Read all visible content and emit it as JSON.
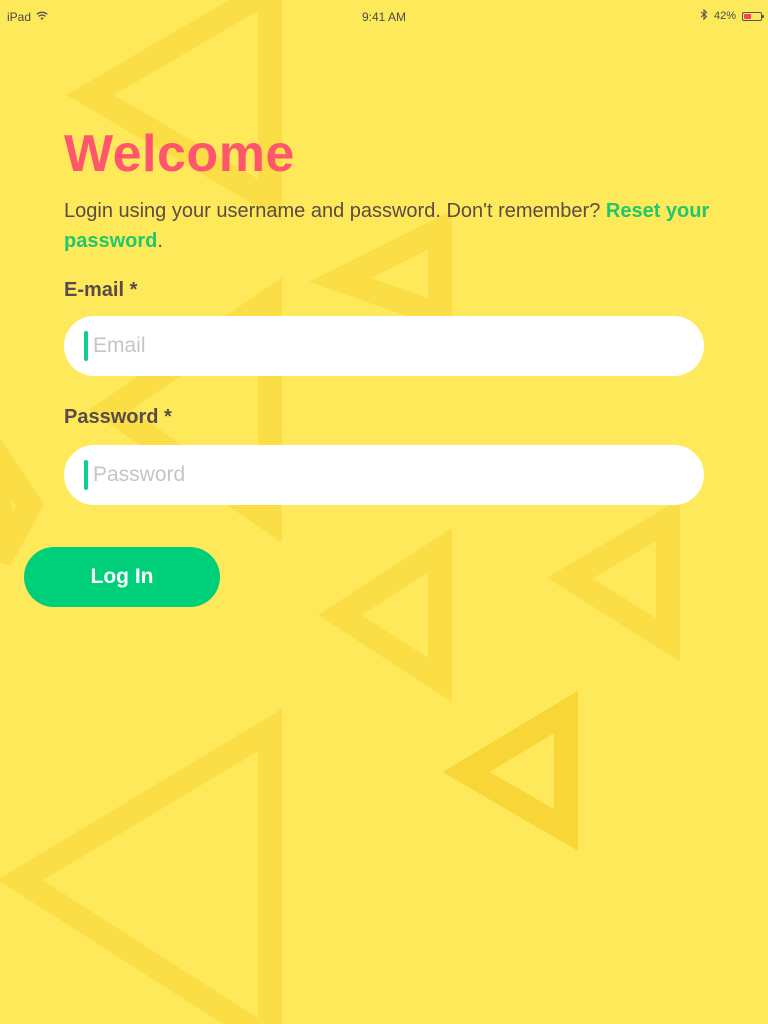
{
  "status_bar": {
    "device": "iPad",
    "time": "9:41 AM",
    "battery_percent": "42%",
    "battery_level": 0.42,
    "icons": [
      "wifi-icon",
      "bluetooth-icon",
      "battery-icon"
    ]
  },
  "login": {
    "title": "Welcome",
    "intro_text": "Login using your username and password. Don't remember? ",
    "reset_link": "Reset your password",
    "reset_suffix": ".",
    "email_label": "E-mail *",
    "email_placeholder": "Email",
    "email_value": "",
    "password_label": "Password *",
    "password_placeholder": "Password",
    "password_value": "",
    "button_label": "Log In"
  },
  "colors": {
    "background": "#fee95a",
    "title": "#ff566e",
    "link": "#1ec86c",
    "button": "#00cf7a",
    "caret": "#0fd08a",
    "text": "#5b4b46",
    "pattern": "#f8d637"
  }
}
